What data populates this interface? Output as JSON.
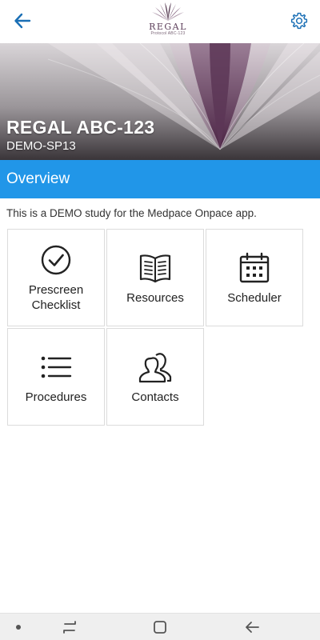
{
  "header": {
    "logo_word": "REGAL",
    "logo_sub": "Protocol ABC-123",
    "back_icon": "arrow-left-icon",
    "settings_icon": "gear-icon",
    "accent": "#1a6fb5"
  },
  "hero": {
    "title": "REGAL ABC-123",
    "subtitle": "DEMO-SP13"
  },
  "overview": {
    "label": "Overview",
    "color": "#2196e8"
  },
  "description": "This is a DEMO study for the Medpace Onpace app.",
  "tiles": [
    {
      "label": "Prescreen\nChecklist",
      "icon": "check-circle-icon"
    },
    {
      "label": "Resources",
      "icon": "book-icon"
    },
    {
      "label": "Scheduler",
      "icon": "calendar-icon"
    },
    {
      "label": "Procedures",
      "icon": "list-icon"
    },
    {
      "label": "Contacts",
      "icon": "users-icon"
    }
  ],
  "system_nav": {
    "items": [
      "dot-icon",
      "recents-icon",
      "home-icon",
      "back-icon"
    ]
  }
}
